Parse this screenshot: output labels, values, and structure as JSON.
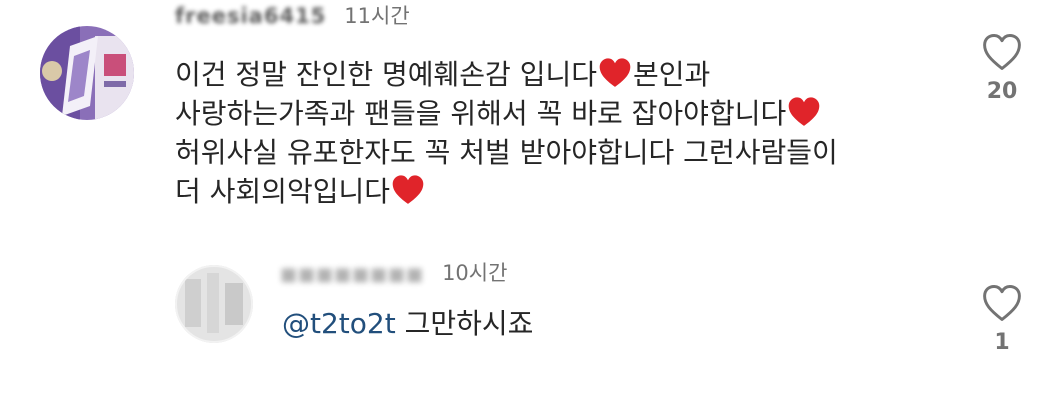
{
  "comment": {
    "username": "freesia6415",
    "time": "11시간",
    "lines": [
      [
        "이건 정말 잔인한 명예훼손감 입니다",
        "heart",
        "본인과"
      ],
      [
        "사랑하는가족과 팬들을 위해서 꼭 바로 잡아야합니다",
        "heart",
        ""
      ],
      [
        "허위사실 유포한자도 꼭 처벌 받아야합니다 그런사람들이",
        "",
        ""
      ],
      [
        "더 사회의악입니다",
        "heart",
        ""
      ]
    ],
    "like_count": "20",
    "like_icon": "heart-outline-icon"
  },
  "reply": {
    "time": "10시간",
    "mention": "@t2to2t",
    "text": " 그만하시죠",
    "like_count": "1",
    "like_icon": "heart-outline-icon"
  },
  "colors": {
    "heart_emoji": "#e0242a",
    "mention": "#224f7c",
    "meta": "#737373"
  }
}
